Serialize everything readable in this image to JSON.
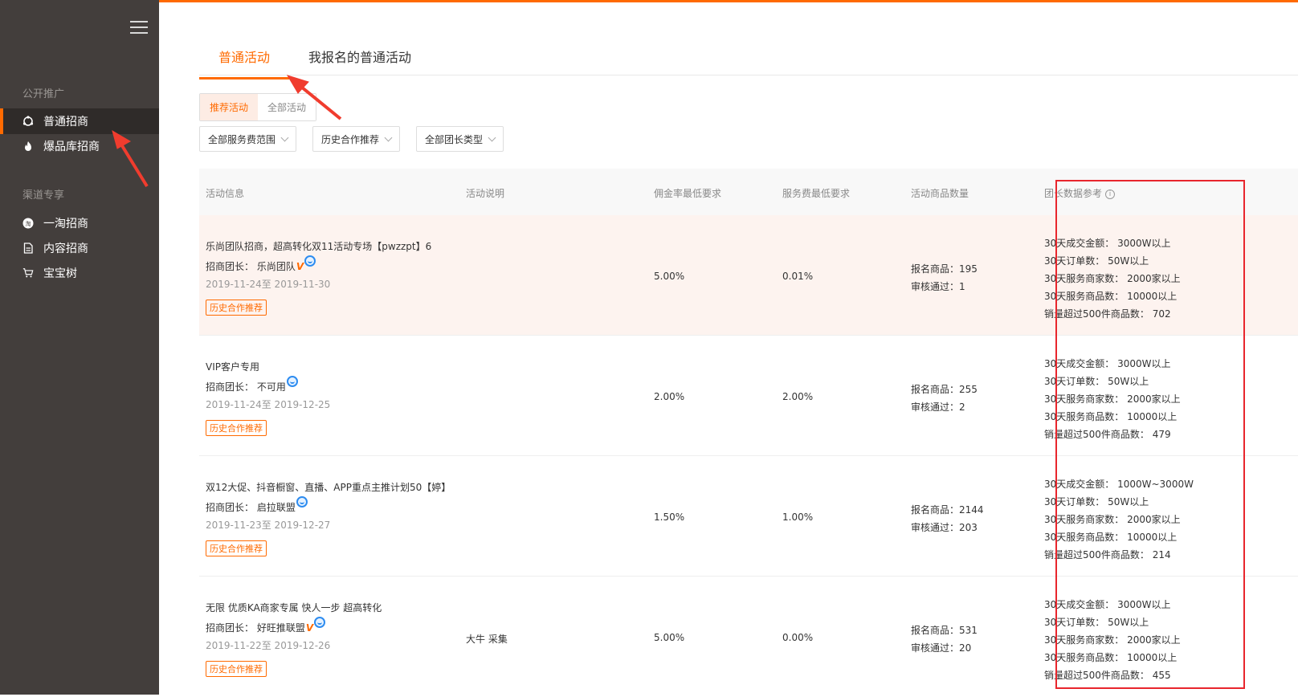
{
  "sidebar": {
    "sections": [
      {
        "title": "公开推广",
        "items": [
          {
            "label": "普通招商",
            "icon": "group-icon",
            "active": true
          },
          {
            "label": "爆品库招商",
            "icon": "fire-icon",
            "active": false
          }
        ]
      },
      {
        "title": "渠道专享",
        "items": [
          {
            "label": "一淘招商",
            "icon": "taobao-icon",
            "active": false
          },
          {
            "label": "内容招商",
            "icon": "document-icon",
            "active": false
          },
          {
            "label": "宝宝树",
            "icon": "cart-icon",
            "active": false
          }
        ]
      }
    ]
  },
  "tabs": [
    {
      "label": "普通活动",
      "active": true
    },
    {
      "label": "我报名的普通活动",
      "active": false
    }
  ],
  "segments": [
    {
      "label": "推荐活动",
      "active": true
    },
    {
      "label": "全部活动",
      "active": false
    }
  ],
  "filters": [
    "全部服务费范围",
    "历史合作推荐",
    "全部团长类型"
  ],
  "table": {
    "headers": {
      "info": "活动信息",
      "desc": "活动说明",
      "commission": "佣金率最低要求",
      "fee": "服务费最低要求",
      "goods": "活动商品数量",
      "stats": "团长数据参考"
    },
    "rows": [
      {
        "title": "乐尚团队招商，超高转化双11活动专场【pwzzpt】6",
        "leader": "招商团长： 乐尚团队",
        "has_v": true,
        "date": "2019-11-24至 2019-11-30",
        "badge": "历史合作推荐",
        "desc": "",
        "commission": "5.00%",
        "fee": "0.01%",
        "registered": "报名商品：195",
        "approved": "审核通过：1",
        "stats": [
          "30天成交金额： 3000W以上",
          "30天订单数： 50W以上",
          "30天服务商家数： 2000家以上",
          "30天服务商品数： 10000以上",
          "销量超过500件商品数： 702"
        ]
      },
      {
        "title": "VIP客户专用",
        "leader": "招商团长： 不可用",
        "has_v": false,
        "date": "2019-11-24至 2019-12-25",
        "badge": "历史合作推荐",
        "desc": "",
        "commission": "2.00%",
        "fee": "2.00%",
        "registered": "报名商品：255",
        "approved": "审核通过：2",
        "stats": [
          "30天成交金额： 3000W以上",
          "30天订单数： 50W以上",
          "30天服务商家数： 2000家以上",
          "30天服务商品数： 10000以上",
          "销量超过500件商品数： 479"
        ]
      },
      {
        "title": "双12大促、抖音橱窗、直播、APP重点主推计划50【婷】",
        "leader": "招商团长： 启拉联盟",
        "has_v": false,
        "date": "2019-11-23至 2019-12-27",
        "badge": "历史合作推荐",
        "desc": "",
        "commission": "1.50%",
        "fee": "1.00%",
        "registered": "报名商品：2144",
        "approved": "审核通过：203",
        "stats": [
          "30天成交金额： 1000W~3000W",
          "30天订单数： 50W以上",
          "30天服务商家数： 2000家以上",
          "30天服务商品数： 10000以上",
          "销量超过500件商品数： 214"
        ]
      },
      {
        "title": "无限 优质KA商家专属 快人一步 超高转化",
        "leader": "招商团长： 好旺推联盟",
        "has_v": true,
        "date": "2019-11-22至 2019-12-26",
        "badge": "历史合作推荐",
        "desc": "大牛 采集",
        "commission": "5.00%",
        "fee": "0.00%",
        "registered": "报名商品：531",
        "approved": "审核通过：20",
        "stats": [
          "30天成交金额： 3000W以上",
          "30天订单数： 50W以上",
          "30天服务商家数： 2000家以上",
          "30天服务商品数： 10000以上",
          "销量超过500件商品数： 455"
        ]
      }
    ]
  },
  "colors": {
    "accent": "#ff6a00",
    "sidebar_bg": "#433e3c",
    "highlight_box": "#e8262d",
    "arrow": "#f03c2e"
  }
}
